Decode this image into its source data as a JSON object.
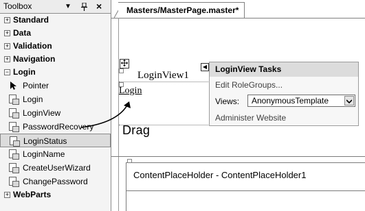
{
  "toolbox": {
    "title": "Toolbox",
    "dropdown_glyph": "▼",
    "pin_glyph": "ᵽ",
    "close_glyph": "×",
    "groups_before": [
      {
        "sign": "+",
        "label": "Standard"
      },
      {
        "sign": "+",
        "label": "Data"
      },
      {
        "sign": "+",
        "label": "Validation"
      },
      {
        "sign": "+",
        "label": "Navigation"
      }
    ],
    "open_group": {
      "sign": "−",
      "label": "Login"
    },
    "items": [
      {
        "label": "Pointer",
        "icon": "pointer-icon"
      },
      {
        "label": "Login",
        "icon": "login-control-icon"
      },
      {
        "label": "LoginView",
        "icon": "loginview-control-icon"
      },
      {
        "label": "PasswordRecovery",
        "icon": "passwordrecovery-control-icon"
      },
      {
        "label": "LoginStatus",
        "icon": "loginstatus-control-icon",
        "selected": true
      },
      {
        "label": "LoginName",
        "icon": "loginname-control-icon"
      },
      {
        "label": "CreateUserWizard",
        "icon": "createuserwizard-control-icon"
      },
      {
        "label": "ChangePassword",
        "icon": "changepassword-control-icon"
      }
    ],
    "groups_after": [
      {
        "sign": "+",
        "label": "WebParts"
      }
    ]
  },
  "editor": {
    "tab_label": "Masters/MasterPage.master*",
    "loginview_label": "LoginView1",
    "login_link": "Login",
    "drag_label": "Drag",
    "content_placeholder": "ContentPlaceHolder - ContentPlaceHolder1"
  },
  "tasks_panel": {
    "title": "LoginView Tasks",
    "edit_link": "Edit RoleGroups...",
    "views_label": "Views:",
    "views_value": "AnonymousTemplate",
    "admin_link": "Administer Website"
  }
}
